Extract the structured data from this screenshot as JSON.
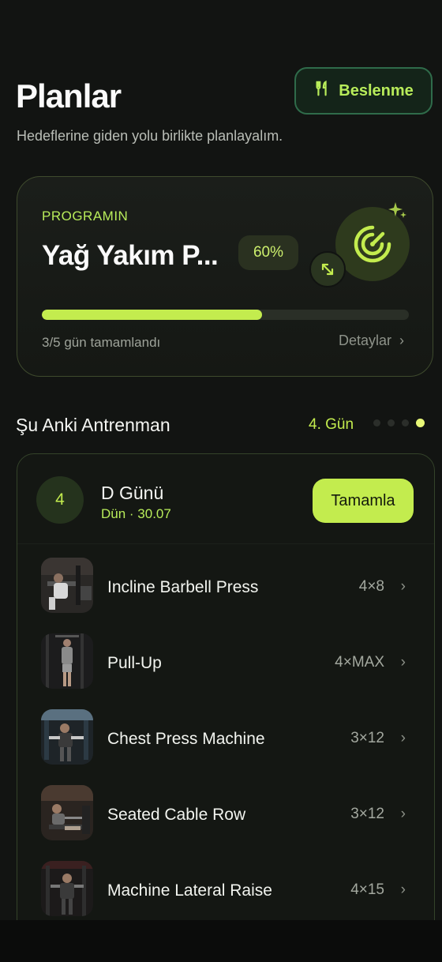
{
  "header": {
    "title": "Planlar",
    "subtitle": "Hedeflerine giden yolu birlikte planlayalım.",
    "nutrition_button": {
      "label": "Beslenme",
      "icon": "fork-knife-icon"
    }
  },
  "program": {
    "label": "PROGRAMIN",
    "name": "Yağ Yakım P...",
    "percent": "60%",
    "progress": 0.6,
    "progress_text": "3/5 gün tamamlandı",
    "details_label": "Detaylar",
    "icons": {
      "target": "target-icon",
      "sparkle": "sparkle-icon",
      "expand": "expand-icon"
    }
  },
  "current_workout": {
    "section_title": "Şu Anki Antrenman",
    "day_label": "4. Gün",
    "pager": {
      "count": 4,
      "active_index": 3
    },
    "day_number": "4",
    "day_title": "D Günü",
    "day_subtitle": "Dün · 30.07",
    "complete_button": "Tamamla",
    "exercises": [
      {
        "name": "Incline Barbell Press",
        "sets": "4×8"
      },
      {
        "name": "Pull-Up",
        "sets": "4×MAX"
      },
      {
        "name": "Chest Press Machine",
        "sets": "3×12"
      },
      {
        "name": "Seated Cable Row",
        "sets": "3×12"
      },
      {
        "name": "Machine Lateral Raise",
        "sets": "4×15"
      }
    ]
  },
  "colors": {
    "accent": "#c3ec4e",
    "background": "#121412",
    "card": "#1b1e1a",
    "muted_text": "#9ea39a"
  }
}
